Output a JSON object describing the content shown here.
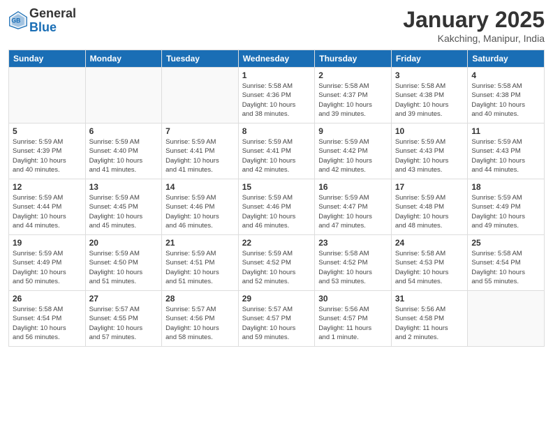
{
  "header": {
    "logo_general": "General",
    "logo_blue": "Blue",
    "title": "January 2025",
    "subtitle": "Kakching, Manipur, India"
  },
  "days_of_week": [
    "Sunday",
    "Monday",
    "Tuesday",
    "Wednesday",
    "Thursday",
    "Friday",
    "Saturday"
  ],
  "weeks": [
    [
      {
        "day": "",
        "text": ""
      },
      {
        "day": "",
        "text": ""
      },
      {
        "day": "",
        "text": ""
      },
      {
        "day": "1",
        "text": "Sunrise: 5:58 AM\nSunset: 4:36 PM\nDaylight: 10 hours\nand 38 minutes."
      },
      {
        "day": "2",
        "text": "Sunrise: 5:58 AM\nSunset: 4:37 PM\nDaylight: 10 hours\nand 39 minutes."
      },
      {
        "day": "3",
        "text": "Sunrise: 5:58 AM\nSunset: 4:38 PM\nDaylight: 10 hours\nand 39 minutes."
      },
      {
        "day": "4",
        "text": "Sunrise: 5:58 AM\nSunset: 4:38 PM\nDaylight: 10 hours\nand 40 minutes."
      }
    ],
    [
      {
        "day": "5",
        "text": "Sunrise: 5:59 AM\nSunset: 4:39 PM\nDaylight: 10 hours\nand 40 minutes."
      },
      {
        "day": "6",
        "text": "Sunrise: 5:59 AM\nSunset: 4:40 PM\nDaylight: 10 hours\nand 41 minutes."
      },
      {
        "day": "7",
        "text": "Sunrise: 5:59 AM\nSunset: 4:41 PM\nDaylight: 10 hours\nand 41 minutes."
      },
      {
        "day": "8",
        "text": "Sunrise: 5:59 AM\nSunset: 4:41 PM\nDaylight: 10 hours\nand 42 minutes."
      },
      {
        "day": "9",
        "text": "Sunrise: 5:59 AM\nSunset: 4:42 PM\nDaylight: 10 hours\nand 42 minutes."
      },
      {
        "day": "10",
        "text": "Sunrise: 5:59 AM\nSunset: 4:43 PM\nDaylight: 10 hours\nand 43 minutes."
      },
      {
        "day": "11",
        "text": "Sunrise: 5:59 AM\nSunset: 4:43 PM\nDaylight: 10 hours\nand 44 minutes."
      }
    ],
    [
      {
        "day": "12",
        "text": "Sunrise: 5:59 AM\nSunset: 4:44 PM\nDaylight: 10 hours\nand 44 minutes."
      },
      {
        "day": "13",
        "text": "Sunrise: 5:59 AM\nSunset: 4:45 PM\nDaylight: 10 hours\nand 45 minutes."
      },
      {
        "day": "14",
        "text": "Sunrise: 5:59 AM\nSunset: 4:46 PM\nDaylight: 10 hours\nand 46 minutes."
      },
      {
        "day": "15",
        "text": "Sunrise: 5:59 AM\nSunset: 4:46 PM\nDaylight: 10 hours\nand 46 minutes."
      },
      {
        "day": "16",
        "text": "Sunrise: 5:59 AM\nSunset: 4:47 PM\nDaylight: 10 hours\nand 47 minutes."
      },
      {
        "day": "17",
        "text": "Sunrise: 5:59 AM\nSunset: 4:48 PM\nDaylight: 10 hours\nand 48 minutes."
      },
      {
        "day": "18",
        "text": "Sunrise: 5:59 AM\nSunset: 4:49 PM\nDaylight: 10 hours\nand 49 minutes."
      }
    ],
    [
      {
        "day": "19",
        "text": "Sunrise: 5:59 AM\nSunset: 4:49 PM\nDaylight: 10 hours\nand 50 minutes."
      },
      {
        "day": "20",
        "text": "Sunrise: 5:59 AM\nSunset: 4:50 PM\nDaylight: 10 hours\nand 51 minutes."
      },
      {
        "day": "21",
        "text": "Sunrise: 5:59 AM\nSunset: 4:51 PM\nDaylight: 10 hours\nand 51 minutes."
      },
      {
        "day": "22",
        "text": "Sunrise: 5:59 AM\nSunset: 4:52 PM\nDaylight: 10 hours\nand 52 minutes."
      },
      {
        "day": "23",
        "text": "Sunrise: 5:58 AM\nSunset: 4:52 PM\nDaylight: 10 hours\nand 53 minutes."
      },
      {
        "day": "24",
        "text": "Sunrise: 5:58 AM\nSunset: 4:53 PM\nDaylight: 10 hours\nand 54 minutes."
      },
      {
        "day": "25",
        "text": "Sunrise: 5:58 AM\nSunset: 4:54 PM\nDaylight: 10 hours\nand 55 minutes."
      }
    ],
    [
      {
        "day": "26",
        "text": "Sunrise: 5:58 AM\nSunset: 4:54 PM\nDaylight: 10 hours\nand 56 minutes."
      },
      {
        "day": "27",
        "text": "Sunrise: 5:57 AM\nSunset: 4:55 PM\nDaylight: 10 hours\nand 57 minutes."
      },
      {
        "day": "28",
        "text": "Sunrise: 5:57 AM\nSunset: 4:56 PM\nDaylight: 10 hours\nand 58 minutes."
      },
      {
        "day": "29",
        "text": "Sunrise: 5:57 AM\nSunset: 4:57 PM\nDaylight: 10 hours\nand 59 minutes."
      },
      {
        "day": "30",
        "text": "Sunrise: 5:56 AM\nSunset: 4:57 PM\nDaylight: 11 hours\nand 1 minute."
      },
      {
        "day": "31",
        "text": "Sunrise: 5:56 AM\nSunset: 4:58 PM\nDaylight: 11 hours\nand 2 minutes."
      },
      {
        "day": "",
        "text": ""
      }
    ]
  ]
}
